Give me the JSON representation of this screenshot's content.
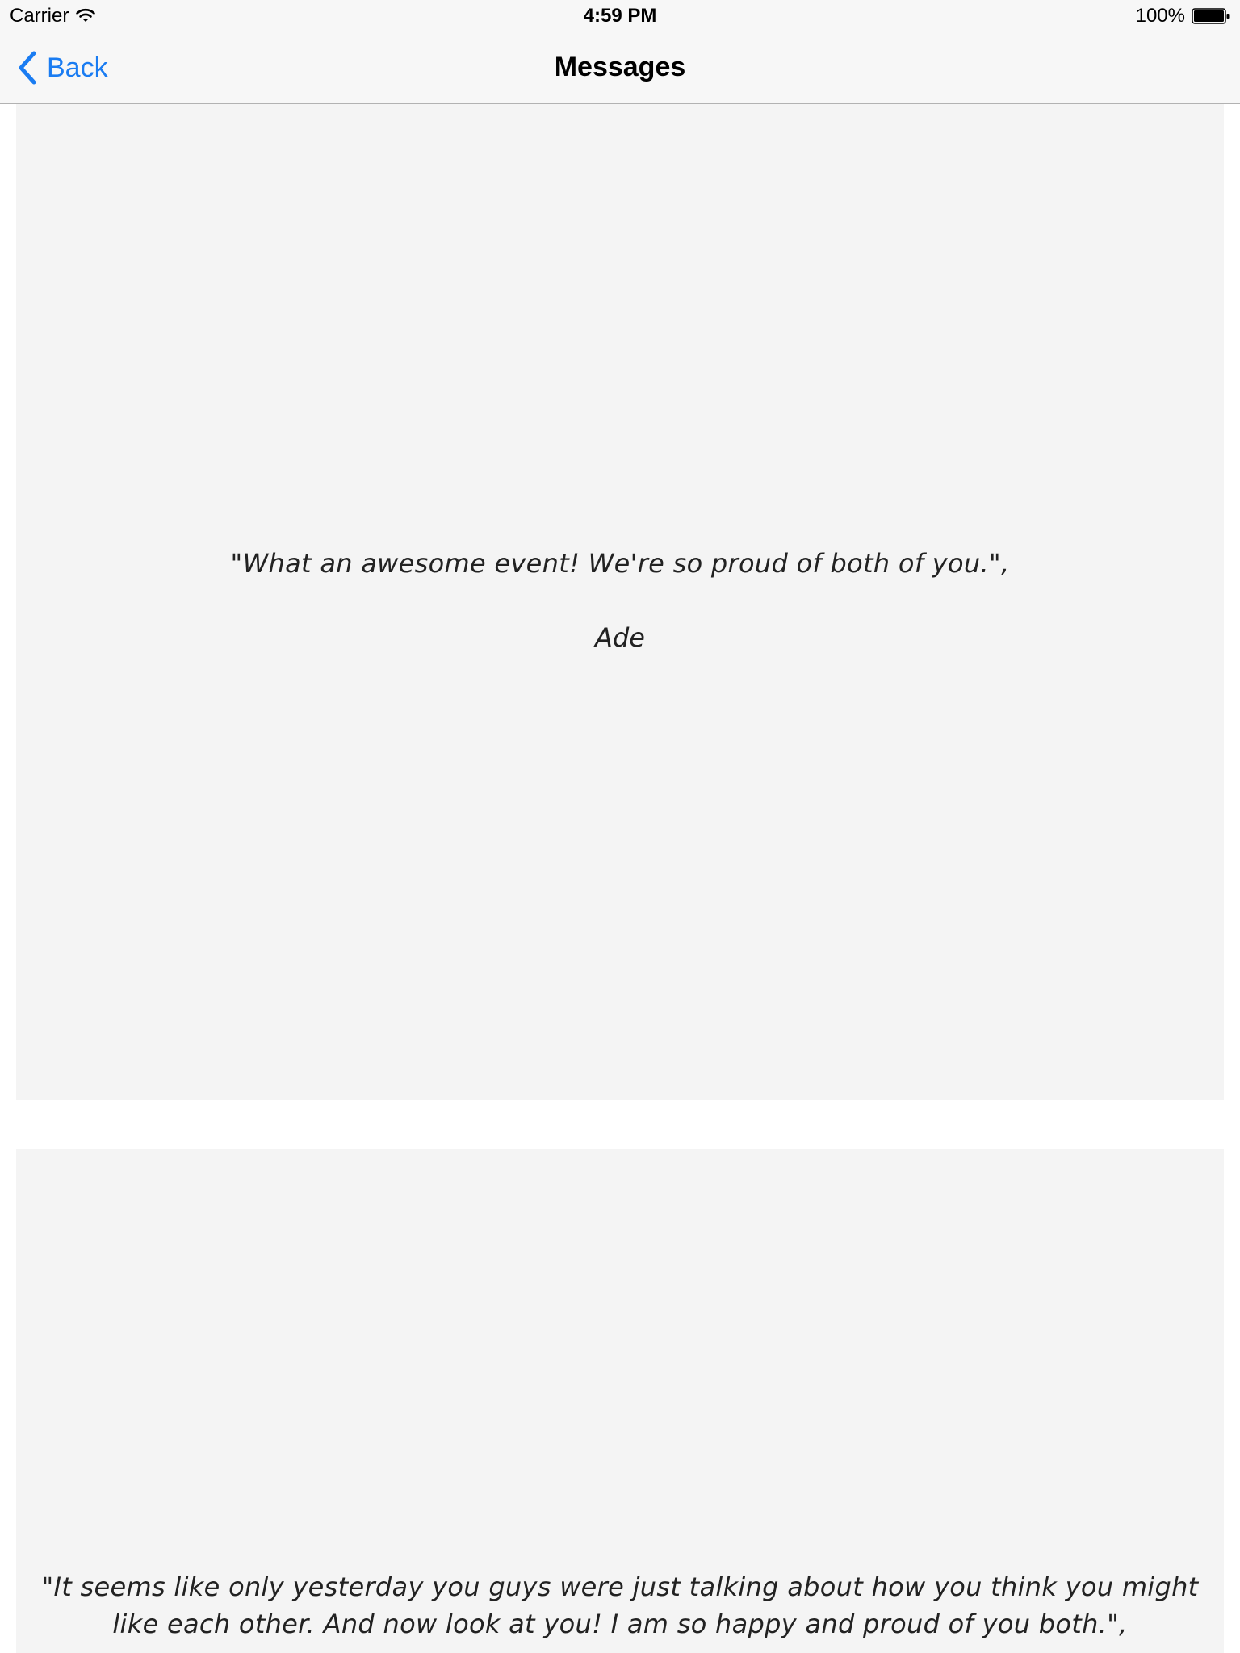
{
  "status_bar": {
    "carrier": "Carrier",
    "time": "4:59 PM",
    "battery": "100%"
  },
  "nav": {
    "back_label": "Back",
    "title": "Messages"
  },
  "messages": [
    {
      "quote": "\"What an awesome event! We're so proud of both of you.\",",
      "author": "Ade"
    },
    {
      "quote": "\"It seems like only yesterday you guys were just talking about how you think you might like each other.  And now look at you! I am so happy and proud of you both.\","
    }
  ],
  "colors": {
    "accent": "#1a7cf2",
    "card_background": "#f4f4f4",
    "bar_background": "#f7f7f7"
  }
}
